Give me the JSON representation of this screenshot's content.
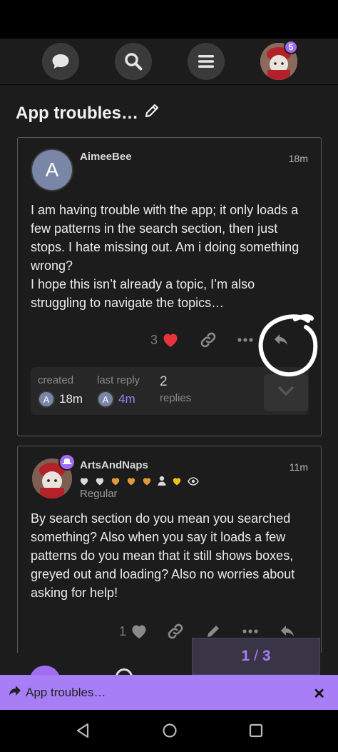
{
  "header": {
    "chat_icon": "chat-bubble-icon",
    "search_icon": "search-icon",
    "menu_icon": "hamburger-menu-icon",
    "notification_count": "5"
  },
  "topic": {
    "title": "App troubles…",
    "edit_icon": "pencil-icon"
  },
  "posts": [
    {
      "username": "AimeeBee",
      "avatar_letter": "A",
      "time": "18m",
      "body": [
        "I am having trouble with the app; it only loads a few patterns in the search section, then just stops. I hate missing out. Am i doing something wrong?",
        "I hope this isn’t already a topic, I’m also struggling to navigate the topics…"
      ],
      "like_count": "3",
      "meta": {
        "created_label": "created",
        "created_value": "18m",
        "last_reply_label": "last reply",
        "last_reply_value": "4m",
        "replies_count": "2",
        "replies_label": "replies"
      }
    },
    {
      "username": "ArtsAndNaps",
      "time": "11m",
      "user_title": "Regular",
      "body": [
        "By search section do you mean you searched something? Also when you say it loads a few patterns do you mean that it still shows boxes, greyed out and loading? Also no worries about asking for help!"
      ],
      "like_count": "1"
    }
  ],
  "progress": {
    "current": "1",
    "separator": "/",
    "total": "3"
  },
  "composer": {
    "label": "App troubles…"
  },
  "colors": {
    "accent": "#a77ef5",
    "like_red": "#e8323c",
    "background": "#1c1c1c"
  }
}
